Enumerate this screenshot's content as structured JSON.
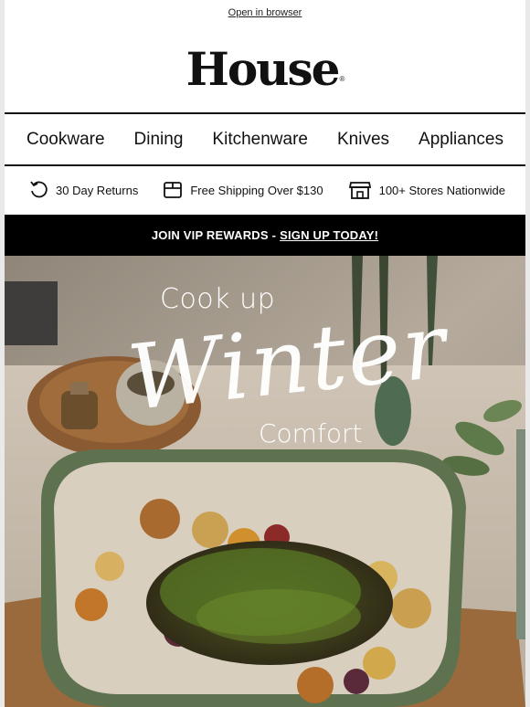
{
  "header": {
    "open_in_browser": "Open in browser",
    "logo_text": "House",
    "logo_mark": "®"
  },
  "nav": {
    "items": [
      "Cookware",
      "Dining",
      "Kitchenware",
      "Knives",
      "Appliances"
    ]
  },
  "perks": [
    {
      "icon": "return-arrow-icon",
      "label": "30 Day Returns"
    },
    {
      "icon": "box-icon",
      "label": "Free Shipping Over $130"
    },
    {
      "icon": "store-icon",
      "label": "100+ Stores Nationwide"
    }
  ],
  "banner": {
    "text": "JOIN VIP REWARDS -",
    "cta": "SIGN UP TODAY!"
  },
  "hero": {
    "line1": "Cook up",
    "line2": "Winter",
    "line3": "Comfort"
  },
  "colors": {
    "banner_bg": "#000000",
    "pan_green": "#5f7250",
    "background": "#ffffff"
  }
}
